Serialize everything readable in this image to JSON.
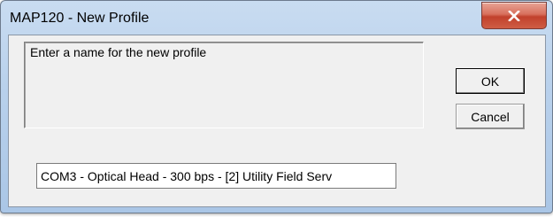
{
  "window": {
    "title": "MAP120 - New Profile"
  },
  "dialog": {
    "prompt": "Enter a name for the new profile",
    "ok_label": "OK",
    "cancel_label": "Cancel",
    "profile_name_value": "COM3 - Optical Head - 300 bps - [2] Utility Field Serv"
  },
  "icons": {
    "close": "close-icon"
  },
  "colors": {
    "close_button": "#c9452f",
    "title_bar": "#b9d1ec",
    "client_background": "#f0f0f0"
  }
}
